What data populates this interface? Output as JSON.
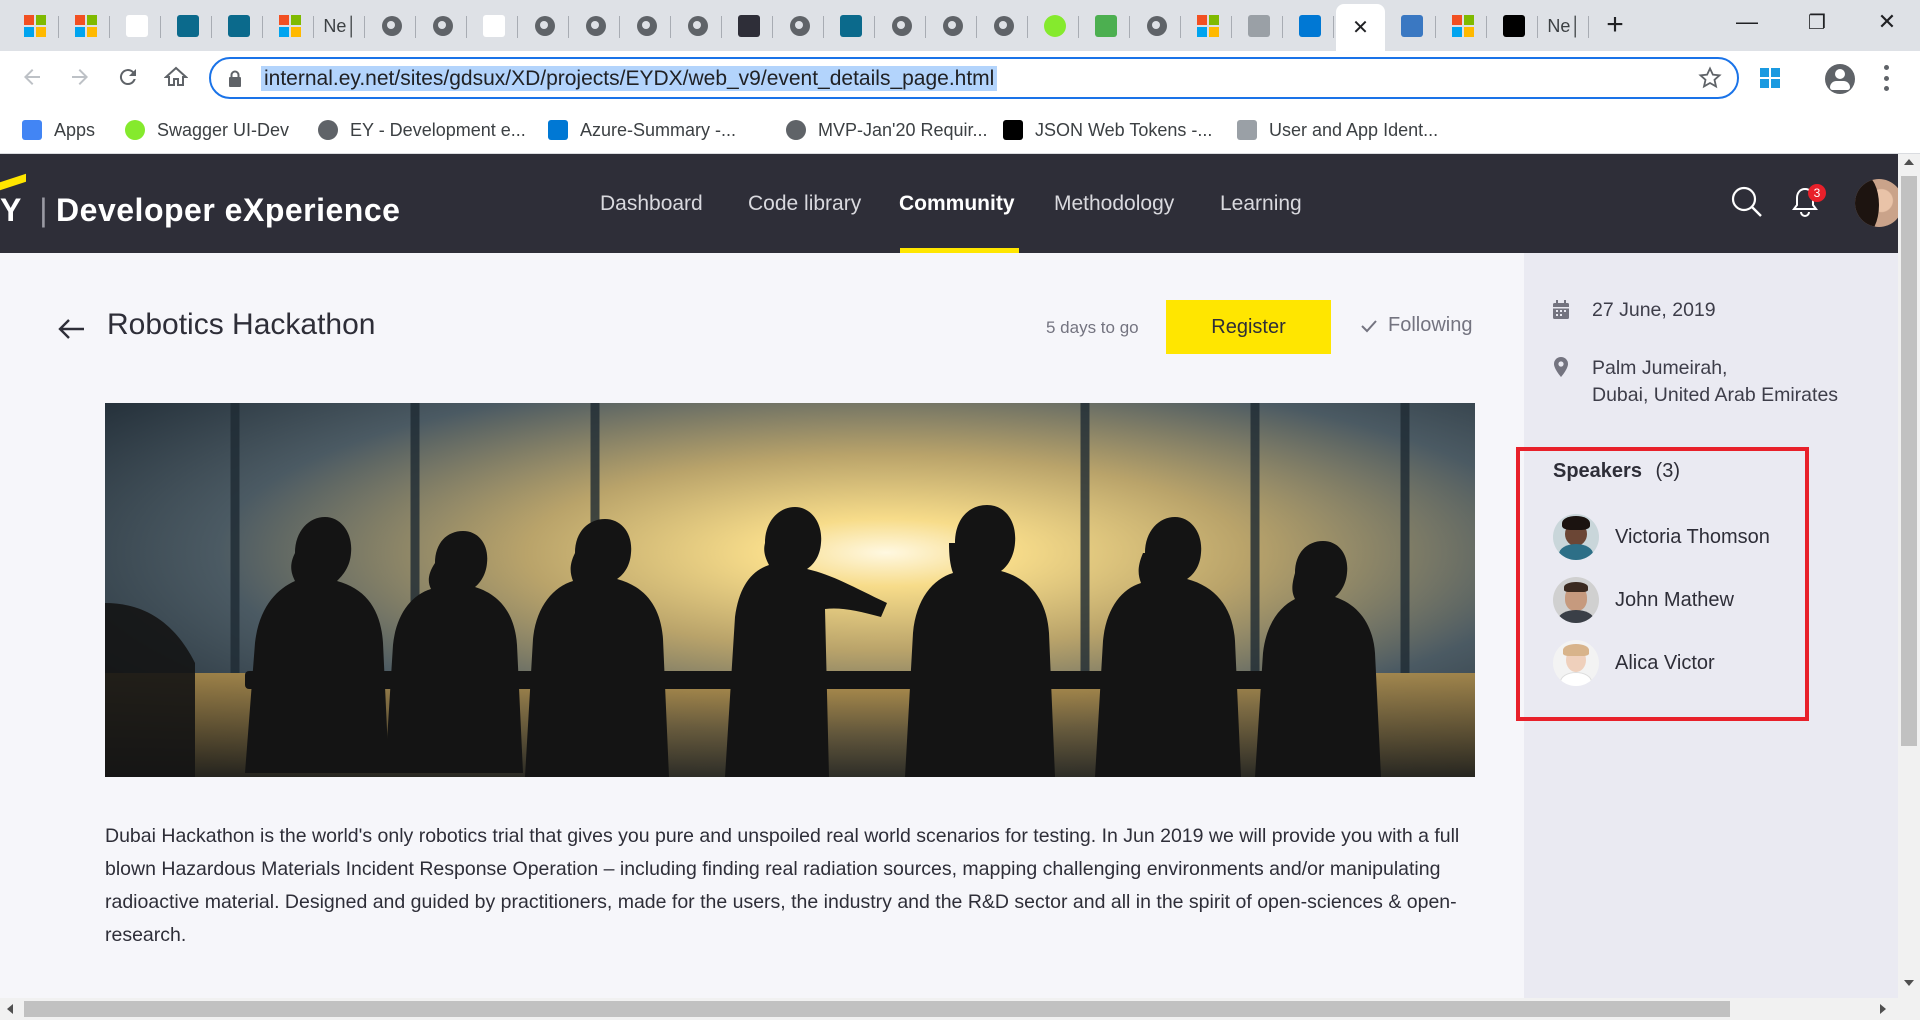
{
  "browser": {
    "tabs": [
      {
        "icon": "microsoft-icon",
        "text": ""
      },
      {
        "icon": "microsoft-icon",
        "text": ""
      },
      {
        "icon": "google-icon",
        "text": ""
      },
      {
        "icon": "sharepoint-icon",
        "text": ""
      },
      {
        "icon": "sharepoint-icon",
        "text": ""
      },
      {
        "icon": "microsoft-icon",
        "text": ""
      },
      {
        "icon": "",
        "text": "Ne│"
      },
      {
        "icon": "globe-icon",
        "text": ""
      },
      {
        "icon": "globe-icon",
        "text": ""
      },
      {
        "icon": "acrobat-icon",
        "text": ""
      },
      {
        "icon": "globe-icon",
        "text": ""
      },
      {
        "icon": "globe-icon",
        "text": ""
      },
      {
        "icon": "globe-icon",
        "text": ""
      },
      {
        "icon": "globe-icon",
        "text": ""
      },
      {
        "icon": "ey-icon",
        "text": ""
      },
      {
        "icon": "globe-icon",
        "text": ""
      },
      {
        "icon": "sharepoint-icon",
        "text": ""
      },
      {
        "icon": "globe-icon",
        "text": ""
      },
      {
        "icon": "globe-icon",
        "text": ""
      },
      {
        "icon": "globe-icon",
        "text": ""
      },
      {
        "icon": "swagger-icon",
        "text": ""
      },
      {
        "icon": "leaf-icon",
        "text": ""
      },
      {
        "icon": "globe-icon",
        "text": ""
      },
      {
        "icon": "microsoft-icon",
        "text": ""
      },
      {
        "icon": "ey-logo-icon",
        "text": ""
      },
      {
        "icon": "azure-devops-icon",
        "text": ""
      },
      {
        "icon": "close-icon",
        "text": "✕"
      },
      {
        "icon": "mvn-icon",
        "text": ""
      },
      {
        "icon": "microsoft-icon",
        "text": ""
      },
      {
        "icon": "jwt-icon",
        "text": ""
      },
      {
        "icon": "",
        "text": "Ne│"
      }
    ],
    "new_tab": "+",
    "window_minimize": "—",
    "window_restore": "❐",
    "window_close": "✕",
    "url": "internal.ey.net/sites/gdsux/XD/projects/EYDX/web_v9/event_details_page.html",
    "bookmarks": [
      {
        "label": "Apps",
        "icon": "apps-icon"
      },
      {
        "label": "Swagger UI-Dev",
        "icon": "swagger-icon"
      },
      {
        "label": "EY - Development e...",
        "icon": "globe-icon"
      },
      {
        "label": "Azure-Summary -...",
        "icon": "azure-devops-icon"
      },
      {
        "label": "MVP-Jan'20 Requir...",
        "icon": "globe-icon"
      },
      {
        "label": "JSON Web Tokens -...",
        "icon": "jwt-icon"
      },
      {
        "label": "User and App Ident...",
        "icon": "document-icon"
      }
    ]
  },
  "site": {
    "brand_prefix": "Y",
    "brand": "Developer eXperience",
    "nav": [
      "Dashboard",
      "Code library",
      "Community",
      "Methodology",
      "Learning"
    ],
    "active_nav": "Community",
    "notification_count": "3"
  },
  "event": {
    "title": "Robotics Hackathon",
    "days_to_go": "5 days to go",
    "register_label": "Register",
    "following_label": "Following",
    "description": "Dubai Hackathon is the world's only robotics trial that gives you pure and unspoiled real world scenarios for testing. In Jun 2019 we will provide you with a full blown Hazardous Materials Incident Response Operation – including finding real radiation sources, mapping challenging environments and/or manipulating radioactive material. Designed and guided by practitioners, made for the users, the industry and the R&D sector and all in the spirit of open-sciences & open-research."
  },
  "sidebar": {
    "date": "27 June, 2019",
    "location_line1": "Palm Jumeirah,",
    "location_line2": "Dubai, United Arab Emirates",
    "speakers_title": "Speakers",
    "speakers_count": "(3)",
    "speakers": [
      {
        "name": "Victoria Thomson"
      },
      {
        "name": "John Mathew"
      },
      {
        "name": "Alica Victor"
      }
    ]
  },
  "colors": {
    "ey_yellow": "#ffe600",
    "header_dark": "#2e2e38",
    "highlight_red": "#e8202a"
  }
}
